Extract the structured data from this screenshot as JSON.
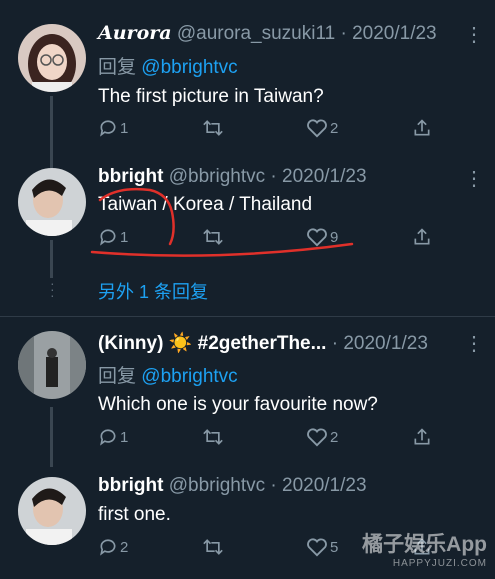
{
  "tweets": [
    {
      "name": "Aurora",
      "handle": "@aurora_suzuki11",
      "sep": " · ",
      "date": "2020/1/23",
      "replying_prefix": "回复",
      "replying_to": "@bbrightvc",
      "text": "The first picture in Taiwan?",
      "reply_count": "1",
      "retweet_count": "",
      "like_count": "2"
    },
    {
      "name": "bbright",
      "handle": "@bbrightvc",
      "sep": " · ",
      "date": "2020/1/23",
      "text": "Taiwan / Korea / Thailand",
      "reply_count": "1",
      "retweet_count": "",
      "like_count": "9"
    },
    {
      "name": "(Kinny) ☀️ #2getherThe...",
      "handle": "",
      "sep": " · ",
      "date": "2020/1/23",
      "replying_prefix": "回复",
      "replying_to": "@bbrightvc",
      "text": "Which one is your favourite now?",
      "reply_count": "1",
      "retweet_count": "",
      "like_count": "2"
    },
    {
      "name": "bbright",
      "handle": "@bbrightvc",
      "sep": " · ",
      "date": "2020/1/23",
      "text": "first one.",
      "reply_count": "2",
      "retweet_count": "",
      "like_count": "5"
    }
  ],
  "more_replies": "另外 1 条回复",
  "watermark": {
    "main": "橘子娱乐App",
    "sub": "HAPPYJUZI.COM"
  },
  "colors": {
    "background": "#15202b",
    "accent": "#1da1f2",
    "muted": "#8899a6",
    "annotation": "#e0302a"
  },
  "icons": [
    "reply-icon",
    "retweet-icon",
    "like-icon",
    "share-icon",
    "more-icon"
  ]
}
